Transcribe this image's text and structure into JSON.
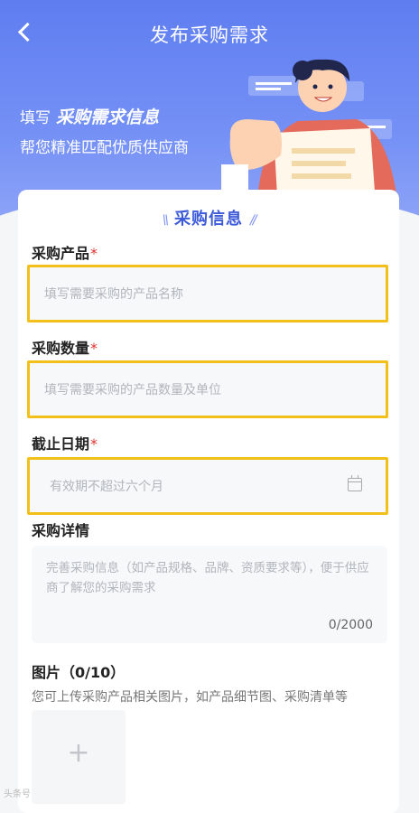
{
  "header": {
    "title": "发布采购需求",
    "hero_prefix": "填写",
    "hero_emphasis": "采购需求信息",
    "hero_line2": "帮您精准匹配优质供应商"
  },
  "section": {
    "title": "采购信息",
    "left_deco": "\\\\",
    "right_deco": "//"
  },
  "form": {
    "product": {
      "label": "采购产品",
      "required": "*",
      "placeholder": "填写需要采购的产品名称",
      "value": ""
    },
    "quantity": {
      "label": "采购数量",
      "required": "*",
      "placeholder": "填写需要采购的产品数量及单位",
      "value": ""
    },
    "deadline": {
      "label": "截止日期",
      "required": "*",
      "placeholder": "有效期不超过六个月",
      "value": ""
    },
    "details": {
      "label": "采购详情",
      "placeholder": "完善采购信息（如产品规格、品牌、资质要求等），便于供应商了解您的采购需求",
      "counter": "0/2000",
      "value": ""
    },
    "images": {
      "label": "图片（0/10）",
      "hint": "您可上传采购产品相关图片，如产品细节图、采购清单等",
      "add_symbol": "+"
    }
  },
  "icons": {
    "back": "chevron-left-icon",
    "calendar": "calendar-icon",
    "add": "plus-icon"
  },
  "colors": {
    "accent": "#3d5bd9",
    "hero": "#6b87f3",
    "highlight": "#f3c019",
    "required": "#e0342f"
  },
  "watermark": "头条号"
}
